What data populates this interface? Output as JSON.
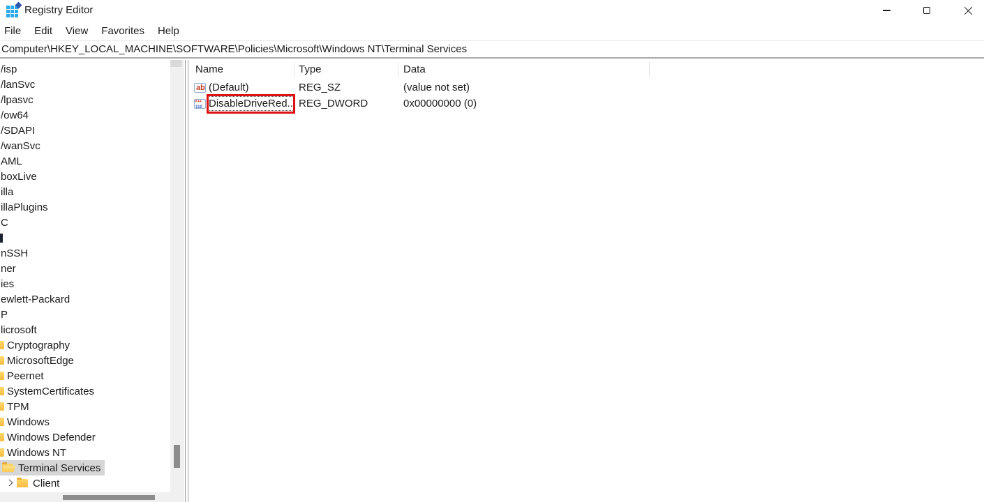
{
  "window": {
    "title": "Registry Editor"
  },
  "menu": {
    "items": [
      "File",
      "Edit",
      "View",
      "Favorites",
      "Help"
    ]
  },
  "address": {
    "value": "Computer\\HKEY_LOCAL_MACHINE\\SOFTWARE\\Policies\\Microsoft\\Windows NT\\Terminal Services"
  },
  "tree": {
    "items": [
      {
        "label": "/isp",
        "kind": "plain"
      },
      {
        "label": "/lanSvc",
        "kind": "plain"
      },
      {
        "label": "/lpasvc",
        "kind": "plain"
      },
      {
        "label": "/ow64",
        "kind": "plain"
      },
      {
        "label": "/SDAPI",
        "kind": "plain"
      },
      {
        "label": "/wanSvc",
        "kind": "plain"
      },
      {
        "label": "AML",
        "kind": "plain"
      },
      {
        "label": "boxLive",
        "kind": "plain"
      },
      {
        "label": "illa",
        "kind": "plain"
      },
      {
        "label": "illaPlugins",
        "kind": "plain"
      },
      {
        "label": "C",
        "kind": "plain"
      },
      {
        "label": "",
        "kind": "bar"
      },
      {
        "label": "nSSH",
        "kind": "plain"
      },
      {
        "label": "ner",
        "kind": "plain"
      },
      {
        "label": "ies",
        "kind": "plain"
      },
      {
        "label": "ewlett-Packard",
        "kind": "plain"
      },
      {
        "label": "P",
        "kind": "plain"
      },
      {
        "label": "licrosoft",
        "kind": "plain"
      },
      {
        "label": "Cryptography",
        "kind": "sliver"
      },
      {
        "label": "MicrosoftEdge",
        "kind": "sliver"
      },
      {
        "label": "Peernet",
        "kind": "sliver"
      },
      {
        "label": "SystemCertificates",
        "kind": "sliver"
      },
      {
        "label": "TPM",
        "kind": "sliver"
      },
      {
        "label": "Windows",
        "kind": "sliver"
      },
      {
        "label": "Windows Defender",
        "kind": "sliver"
      },
      {
        "label": "Windows NT",
        "kind": "sliver"
      },
      {
        "label": "Terminal Services",
        "kind": "selected"
      },
      {
        "label": "Client",
        "kind": "child"
      }
    ],
    "selected_item": "Terminal Services"
  },
  "list": {
    "columns": [
      "Name",
      "Type",
      "Data"
    ],
    "rows": [
      {
        "icon": "reg-sz",
        "name": "(Default)",
        "type": "REG_SZ",
        "data": "(value not set)",
        "annotated": false
      },
      {
        "icon": "reg-dword",
        "name": "DisableDriveRed...",
        "type": "REG_DWORD",
        "data": "0x00000000 (0)",
        "annotated": true
      }
    ]
  },
  "colors": {
    "annotation_red": "#dd1111",
    "selection_gray": "#d6d6d6",
    "folder_yellow": "#f8bd44",
    "registry_icon_blue": "#2ba9e8"
  }
}
